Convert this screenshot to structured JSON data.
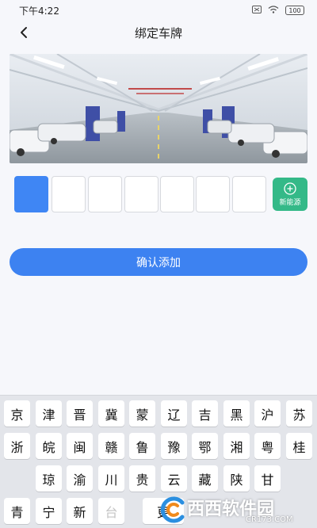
{
  "status_bar": {
    "time": "下午4:22",
    "battery": "100"
  },
  "header": {
    "title": "绑定车牌",
    "back_icon": "chevron-left-icon"
  },
  "plate_input": {
    "slots": 7,
    "active_index": 0,
    "new_energy_label": "新能源",
    "new_energy_color": "#34b988",
    "active_color": "#3f86f4"
  },
  "confirm_button": {
    "label": "确认添加",
    "color": "#3d82f1"
  },
  "keyboard": {
    "rows": [
      [
        "京",
        "津",
        "晋",
        "冀",
        "蒙",
        "辽",
        "吉",
        "黑",
        "沪",
        "苏"
      ],
      [
        "浙",
        "皖",
        "闽",
        "赣",
        "鲁",
        "豫",
        "鄂",
        "湘",
        "粤",
        "桂"
      ],
      [
        "琼",
        "渝",
        "川",
        "贵",
        "云",
        "藏",
        "陕",
        "甘"
      ],
      [
        "青",
        "宁",
        "新",
        "台",
        "更"
      ]
    ],
    "disabled_keys": [
      "台"
    ]
  },
  "watermark": {
    "text": "西西软件园",
    "url": "CR173.COM"
  }
}
